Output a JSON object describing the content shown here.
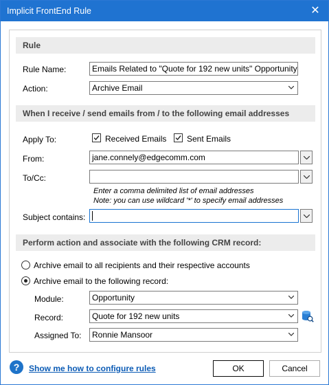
{
  "window": {
    "title": "Implicit FrontEnd Rule",
    "close_icon": "close-icon"
  },
  "rule_section": {
    "header": "Rule",
    "rule_name_label": "Rule Name:",
    "rule_name_value": "Emails Related to \"Quote for 192 new units\" Opportunity",
    "action_label": "Action:",
    "action_value": "Archive Email"
  },
  "email_section": {
    "header": "When I receive / send emails from / to the following email addresses",
    "apply_to_label": "Apply To:",
    "received_label": "Received Emails",
    "received_checked": true,
    "sent_label": "Sent Emails",
    "sent_checked": true,
    "from_label": "From:",
    "from_value": "jane.connely@edgecomm.com",
    "tocc_label": "To/Cc:",
    "tocc_value": "",
    "hint_line1": "Enter a comma delimited list of email addresses",
    "hint_line2": "Note: you can use wildcard '*' to specify email addresses",
    "subject_label": "Subject contains:",
    "subject_value": ""
  },
  "crm_section": {
    "header": "Perform action and associate with the following CRM record:",
    "radio_all_label": "Archive email to all recipients and their respective accounts",
    "radio_all_selected": false,
    "radio_record_label": "Archive email to the following record:",
    "radio_record_selected": true,
    "module_label": "Module:",
    "module_value": "Opportunity",
    "record_label": "Record:",
    "record_value": "Quote for 192 new units",
    "assigned_label": "Assigned To:",
    "assigned_value": "Ronnie Mansoor"
  },
  "footer": {
    "help_glyph": "?",
    "help_link": "Show me how to configure rules",
    "ok_label": "OK",
    "cancel_label": "Cancel"
  },
  "colors": {
    "titlebar": "#1f73d1",
    "link": "#0b5bb5",
    "section_bg": "#ececec"
  }
}
